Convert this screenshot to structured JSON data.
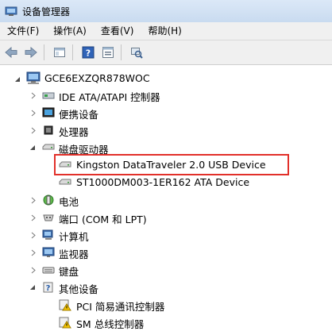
{
  "window": {
    "title": "设备管理器"
  },
  "menu": [
    "文件(F)",
    "操作(A)",
    "查看(V)",
    "帮助(H)"
  ],
  "toolbar": {
    "buttons": [
      "back-icon",
      "forward-icon",
      "show-hide-console-icon",
      "help-icon",
      "properties-icon",
      "scan-hardware-icon"
    ]
  },
  "tree": {
    "root": "GCE6EXZQR878WOC",
    "items": [
      {
        "label": "IDE ATA/ATAPI 控制器",
        "icon": "ide-controller-icon",
        "state": "collapsed"
      },
      {
        "label": "便携设备",
        "icon": "portable-device-icon",
        "state": "collapsed"
      },
      {
        "label": "处理器",
        "icon": "processor-icon",
        "state": "collapsed"
      },
      {
        "label": "磁盘驱动器",
        "icon": "disk-drive-icon",
        "state": "expanded",
        "children": [
          {
            "label": "Kingston DataTraveler 2.0 USB Device",
            "icon": "disk-drive-icon"
          },
          {
            "label": "ST1000DM003-1ER162 ATA Device",
            "icon": "disk-drive-icon"
          }
        ]
      },
      {
        "label": "电池",
        "icon": "battery-icon",
        "state": "collapsed"
      },
      {
        "label": "端口 (COM 和 LPT)",
        "icon": "port-icon",
        "state": "collapsed"
      },
      {
        "label": "计算机",
        "icon": "computer-icon",
        "state": "collapsed"
      },
      {
        "label": "监视器",
        "icon": "monitor-icon",
        "state": "collapsed"
      },
      {
        "label": "键盘",
        "icon": "keyboard-icon",
        "state": "collapsed"
      },
      {
        "label": "其他设备",
        "icon": "other-devices-icon",
        "state": "expanded",
        "children": [
          {
            "label": "PCI 简易通讯控制器",
            "icon": "warning-device-icon"
          },
          {
            "label": "SM 总线控制器",
            "icon": "warning-device-icon"
          }
        ]
      }
    ]
  },
  "colors": {
    "highlight_border": "#e2302a",
    "titlebar": "#d3e3f5"
  }
}
